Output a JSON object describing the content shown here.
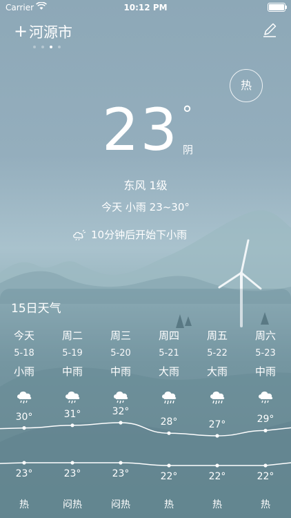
{
  "status_bar": {
    "carrier": "Carrier",
    "time": "10:12 PM"
  },
  "header": {
    "add_icon": "plus-icon",
    "city": "河源市",
    "page_dots": 4,
    "active_dot": 3,
    "edit_icon": "pencil-icon"
  },
  "current": {
    "badge": "热",
    "temperature": "23",
    "degree_symbol": "°",
    "condition": "阴",
    "wind": "东风 1级",
    "today_summary": "今天 小雨 23~30°",
    "rain_alert": "10分钟后开始下小雨"
  },
  "forecast": {
    "title": "15日天气",
    "days": [
      {
        "name": "今天",
        "date": "5-18",
        "condition": "小雨",
        "icon": "rain-cloud-icon",
        "high": 30,
        "low": 23,
        "feel": "热"
      },
      {
        "name": "周二",
        "date": "5-19",
        "condition": "中雨",
        "icon": "rain-cloud-icon",
        "high": 31,
        "low": 23,
        "feel": "闷热"
      },
      {
        "name": "周三",
        "date": "5-20",
        "condition": "中雨",
        "icon": "rain-cloud-icon",
        "high": 32,
        "low": 23,
        "feel": "闷热"
      },
      {
        "name": "周四",
        "date": "5-21",
        "condition": "大雨",
        "icon": "heavy-rain-cloud-icon",
        "high": 28,
        "low": 22,
        "feel": "热"
      },
      {
        "name": "周五",
        "date": "5-22",
        "condition": "大雨",
        "icon": "heavy-rain-cloud-icon",
        "high": 27,
        "low": 22,
        "feel": "热"
      },
      {
        "name": "周六",
        "date": "5-23",
        "condition": "中雨",
        "icon": "rain-cloud-icon",
        "high": 29,
        "low": 22,
        "feel": "热"
      }
    ]
  },
  "colors": {
    "sky_top": "#8da8b7",
    "mountain": "#6d8c96",
    "text": "#ffffff"
  }
}
